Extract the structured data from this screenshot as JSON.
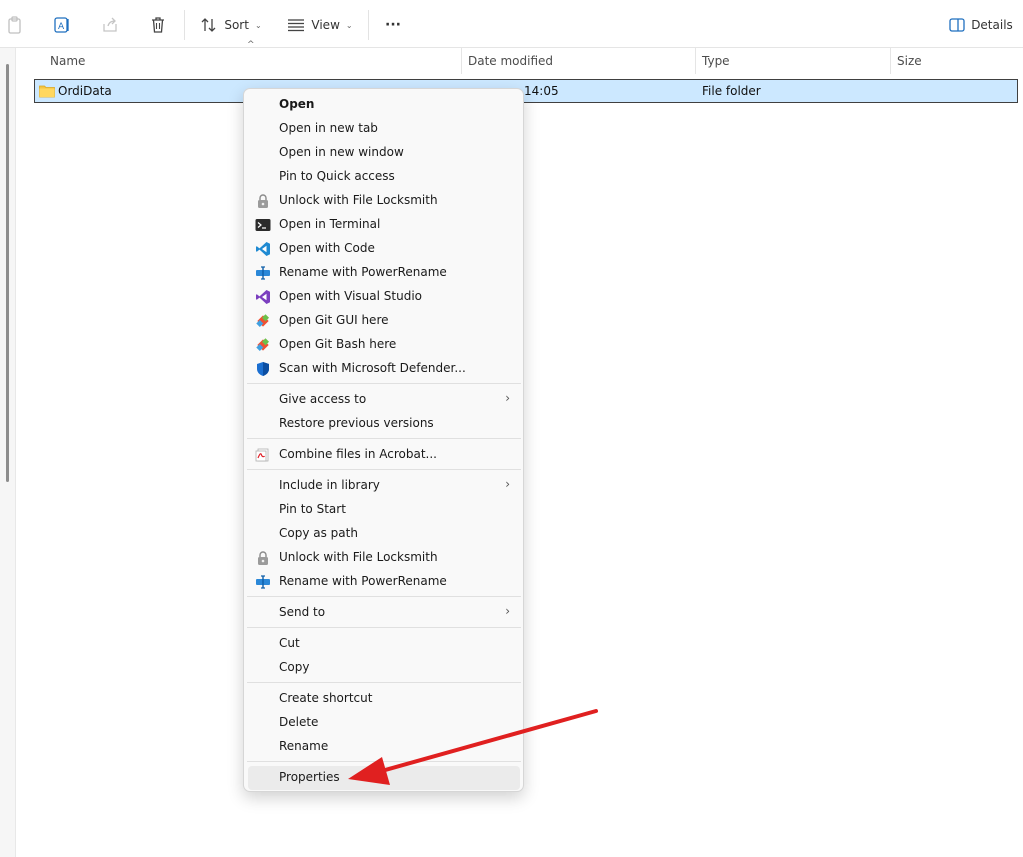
{
  "toolbar": {
    "sort_label": "Sort",
    "view_label": "View",
    "more_label": "···",
    "details_label": "Details"
  },
  "columns": {
    "name": "Name",
    "date_modified": "Date modified",
    "type": "Type",
    "size": "Size"
  },
  "selected_row": {
    "name": "OrdiData",
    "date_fragment": "14:05",
    "type": "File folder"
  },
  "context_menu": {
    "items": [
      {
        "label": "Open",
        "icon": "",
        "bold": true
      },
      {
        "label": "Open in new tab",
        "icon": ""
      },
      {
        "label": "Open in new window",
        "icon": ""
      },
      {
        "label": "Pin to Quick access",
        "icon": ""
      },
      {
        "label": "Unlock with File Locksmith",
        "icon": "lock-icon"
      },
      {
        "label": "Open in Terminal",
        "icon": "terminal-icon"
      },
      {
        "label": "Open with Code",
        "icon": "vscode-icon"
      },
      {
        "label": "Rename with PowerRename",
        "icon": "powerrename-icon"
      },
      {
        "label": "Open with Visual Studio",
        "icon": "visual-studio-icon"
      },
      {
        "label": "Open Git GUI here",
        "icon": "git-icon"
      },
      {
        "label": "Open Git Bash here",
        "icon": "git-icon"
      },
      {
        "label": "Scan with Microsoft Defender...",
        "icon": "defender-shield-icon"
      },
      {
        "label": "Give access to",
        "icon": "",
        "submenu": true
      },
      {
        "label": "Restore previous versions",
        "icon": ""
      },
      {
        "label": "Combine files in Acrobat...",
        "icon": "acrobat-icon"
      },
      {
        "label": "Include in library",
        "icon": "",
        "submenu": true
      },
      {
        "label": "Pin to Start",
        "icon": ""
      },
      {
        "label": "Copy as path",
        "icon": ""
      },
      {
        "label": "Unlock with File Locksmith",
        "icon": "lock-icon"
      },
      {
        "label": "Rename with PowerRename",
        "icon": "powerrename-icon"
      },
      {
        "label": "Send to",
        "icon": "",
        "submenu": true
      },
      {
        "label": "Cut",
        "icon": ""
      },
      {
        "label": "Copy",
        "icon": ""
      },
      {
        "label": "Create shortcut",
        "icon": ""
      },
      {
        "label": "Delete",
        "icon": ""
      },
      {
        "label": "Rename",
        "icon": ""
      },
      {
        "label": "Properties",
        "icon": "",
        "highlighted": true
      }
    ],
    "submenu_glyph": "›"
  },
  "colors": {
    "selection": "#cce8ff",
    "arrow": "#e02020",
    "menu_bg": "#f9f9f9"
  }
}
